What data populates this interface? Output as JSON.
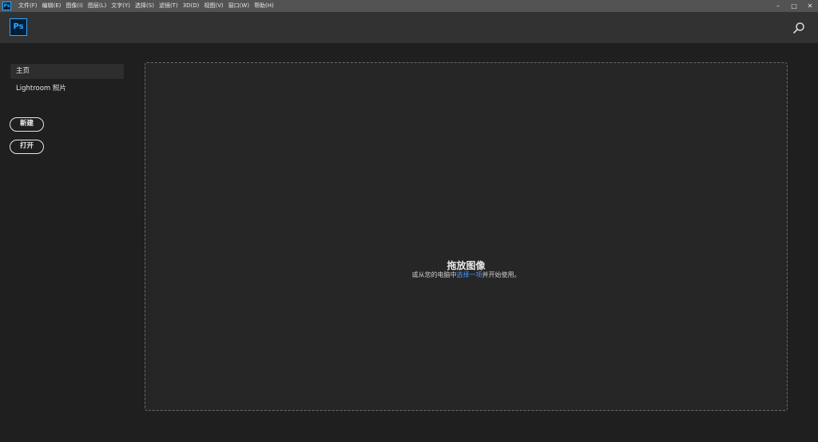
{
  "menubar": {
    "app_icon_label": "Ps",
    "items": [
      "文件(F)",
      "编辑(E)",
      "图像(I)",
      "图层(L)",
      "文字(Y)",
      "选择(S)",
      "滤镜(T)",
      "3D(D)",
      "视图(V)",
      "窗口(W)",
      "帮助(H)"
    ],
    "controls": [
      "–",
      "□",
      "✕"
    ]
  },
  "header": {
    "logo_label": "Ps",
    "search_icon": "search-icon"
  },
  "sidebar": {
    "items": [
      {
        "label": "主页"
      },
      {
        "label": "Lightroom 照片"
      }
    ],
    "new_label": "新建",
    "open_label": "打开"
  },
  "dropzone": {
    "title": "拖放图像",
    "subtitle_prefix": "或从您的电脑中",
    "subtitle_link": "选择一项",
    "subtitle_suffix": "并开始使用。"
  },
  "colors": {
    "accent": "#31a8ff",
    "link": "#4a9cff",
    "background": "#1f1f1f"
  }
}
